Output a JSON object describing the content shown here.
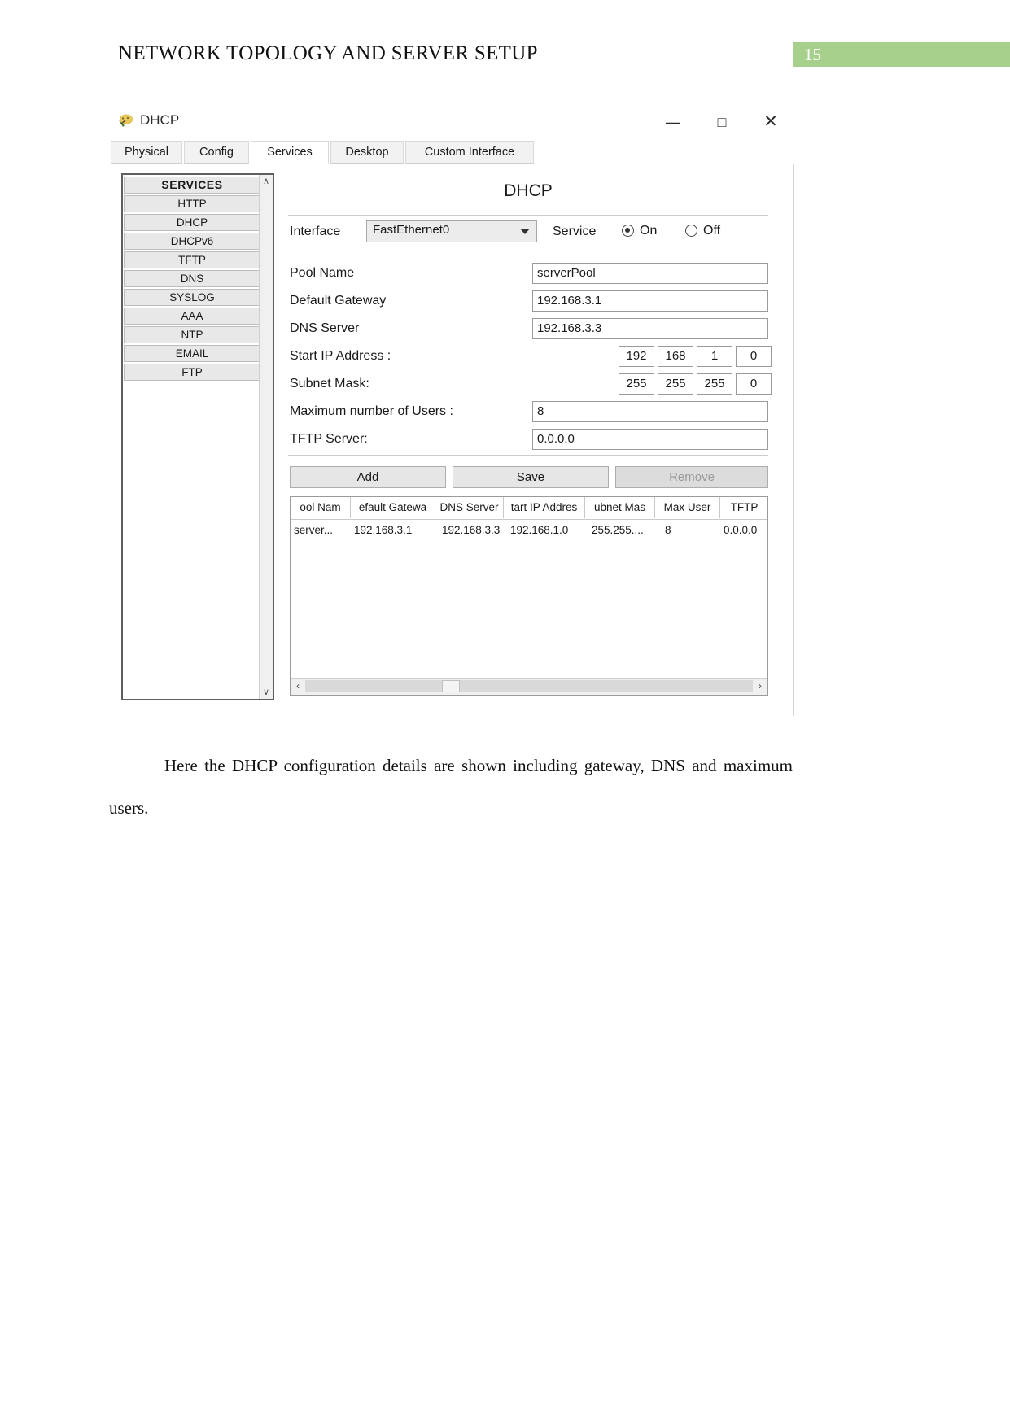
{
  "document": {
    "title": "NETWORK TOPOLOGY AND SERVER SETUP",
    "page_number": "15",
    "badge_color": "#a8d08d",
    "caption": "Here the DHCP configuration details are shown including gateway, DNS and maximum users."
  },
  "window": {
    "title": "DHCP",
    "icon": "packet-tracer-server-icon",
    "controls": {
      "minimize": "—",
      "maximize": "□",
      "close": "✕"
    }
  },
  "tabs": [
    {
      "label": "Physical",
      "active": false
    },
    {
      "label": "Config",
      "active": false
    },
    {
      "label": "Services",
      "active": true
    },
    {
      "label": "Desktop",
      "active": false
    },
    {
      "label": "Custom Interface",
      "active": false
    }
  ],
  "sidebar": {
    "header": "SERVICES",
    "items": [
      {
        "label": "HTTP"
      },
      {
        "label": "DHCP"
      },
      {
        "label": "DHCPv6"
      },
      {
        "label": "TFTP"
      },
      {
        "label": "DNS"
      },
      {
        "label": "SYSLOG"
      },
      {
        "label": "AAA"
      },
      {
        "label": "NTP"
      },
      {
        "label": "EMAIL"
      },
      {
        "label": "FTP"
      }
    ],
    "scroll_up": "∧",
    "scroll_down": "∨"
  },
  "panel": {
    "title": "DHCP",
    "interface": {
      "label": "Interface",
      "value": "FastEthernet0"
    },
    "service": {
      "label": "Service",
      "on_label": "On",
      "off_label": "Off",
      "selected": "On"
    },
    "fields": {
      "pool_name_label": "Pool Name",
      "pool_name_value": "serverPool",
      "default_gateway_label": "Default Gateway",
      "default_gateway_value": "192.168.3.1",
      "dns_server_label": "DNS Server",
      "dns_server_value": "192.168.3.3",
      "start_ip_label": "Start IP Address :",
      "start_ip_octets": [
        "192",
        "168",
        "1",
        "0"
      ],
      "subnet_mask_label": "Subnet Mask:",
      "subnet_mask_octets": [
        "255",
        "255",
        "255",
        "0"
      ],
      "max_users_label": "Maximum number of Users :",
      "max_users_value": "8",
      "tftp_server_label": "TFTP Server:",
      "tftp_server_value": "0.0.0.0"
    },
    "buttons": {
      "add": "Add",
      "save": "Save",
      "remove": "Remove"
    },
    "table": {
      "headers": [
        "ool Nam",
        "efault Gatewa",
        "DNS Server",
        "tart IP Addres",
        "ubnet Mas",
        "Max User",
        "TFTP"
      ],
      "rows": [
        [
          "server...",
          "192.168.3.1",
          "192.168.3.3",
          "192.168.1.0",
          "255.255....",
          "8",
          "0.0.0.0"
        ]
      ],
      "scroll_left": "‹",
      "scroll_right": "›"
    }
  }
}
